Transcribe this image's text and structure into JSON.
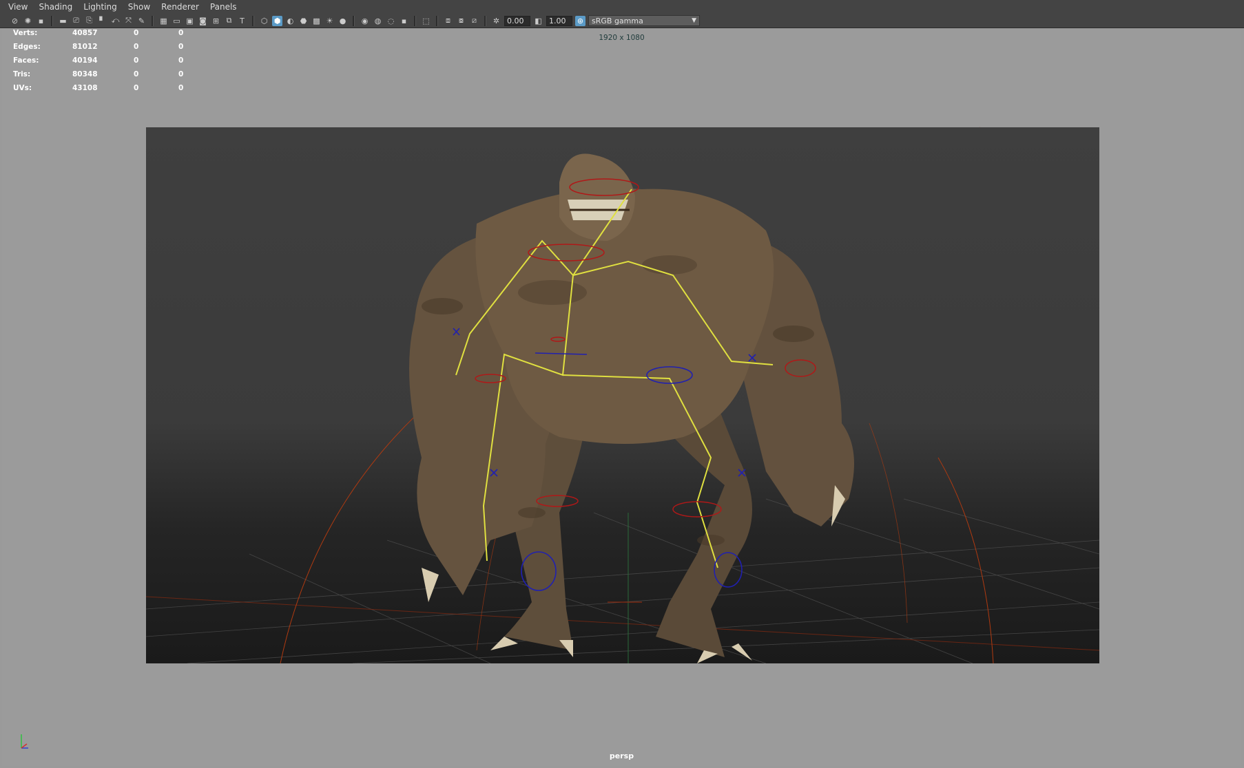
{
  "menu": [
    "View",
    "Shading",
    "Lighting",
    "Show",
    "Renderer",
    "Panels"
  ],
  "toolbar": {
    "exposure_value": "0.00",
    "gamma_value": "1.00",
    "colorspace_selected": "sRGB gamma",
    "icons_left": [
      "select-camera-icon",
      "camera-attributes-icon",
      "bookmark-icon",
      "image-plane-icon",
      "rotate-tool-icon",
      "grid-toggle-icon",
      "film-gate-icon",
      "resolution-gate-icon",
      "gate-mask-icon",
      "field-chart-icon",
      "safe-action-icon",
      "safe-title-icon"
    ],
    "icons_right": [
      "wireframe-icon",
      "smooth-shade-icon",
      "wireframe-on-shaded-icon",
      "default-material-icon",
      "textured-icon",
      "use-lights-icon",
      "shadows-icon",
      "ambient-occlusion-icon",
      "motion-blur-icon",
      "anti-alias-icon",
      "isolate-select-icon",
      "xray-icon",
      "xray-joints-icon",
      "xray-components-icon"
    ]
  },
  "hud": {
    "rows": [
      {
        "label": "Verts:",
        "v1": "40857",
        "v2": "0",
        "v3": "0"
      },
      {
        "label": "Edges:",
        "v1": "81012",
        "v2": "0",
        "v3": "0"
      },
      {
        "label": "Faces:",
        "v1": "40194",
        "v2": "0",
        "v3": "0"
      },
      {
        "label": "Tris:",
        "v1": "80348",
        "v2": "0",
        "v3": "0"
      },
      {
        "label": "UVs:",
        "v1": "43108",
        "v2": "0",
        "v3": "0"
      }
    ]
  },
  "viewport": {
    "resolution_label": "1920 x 1080",
    "camera_label": "persp",
    "colors": {
      "gate_bg": "#3b3b3b",
      "skin": "#6e5a43",
      "joints": "#e0e040",
      "controls_red": "#b01818",
      "controls_blue": "#2020b0",
      "camera_lines": "#b03a10"
    }
  }
}
